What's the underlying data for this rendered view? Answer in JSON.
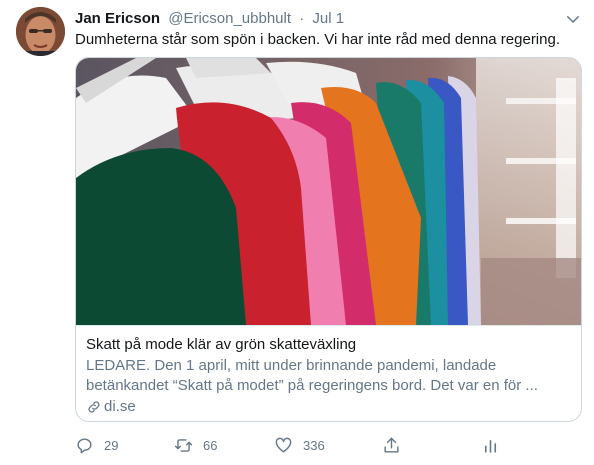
{
  "tweet": {
    "author_name": "Jan Ericson",
    "author_handle": "@Ericson_ubbhult",
    "separator": "·",
    "time": "Jul 1",
    "text": "Dumheterna står som spön i backen. Vi har inte råd med denna regering.",
    "avatar_icon": "user-avatar",
    "caret_icon": "chevron-down-icon"
  },
  "card": {
    "title": "Skatt på mode klär av grön skatteväxling",
    "description": "LEDARE. Den 1 april, mitt under brinnande pandemi, landade betänkandet “Skatt på modet” på regeringens bord. Det var en för ...",
    "domain": "di.se",
    "link_icon": "link-icon"
  },
  "actions": {
    "reply_count": "29",
    "retweet_count": "66",
    "like_count": "336",
    "icons": [
      "reply-icon",
      "retweet-icon",
      "like-icon",
      "share-icon",
      "analytics-icon"
    ]
  },
  "colors": {
    "text_primary": "#14171a",
    "text_secondary": "#657786",
    "border": "#ccd6dd"
  }
}
